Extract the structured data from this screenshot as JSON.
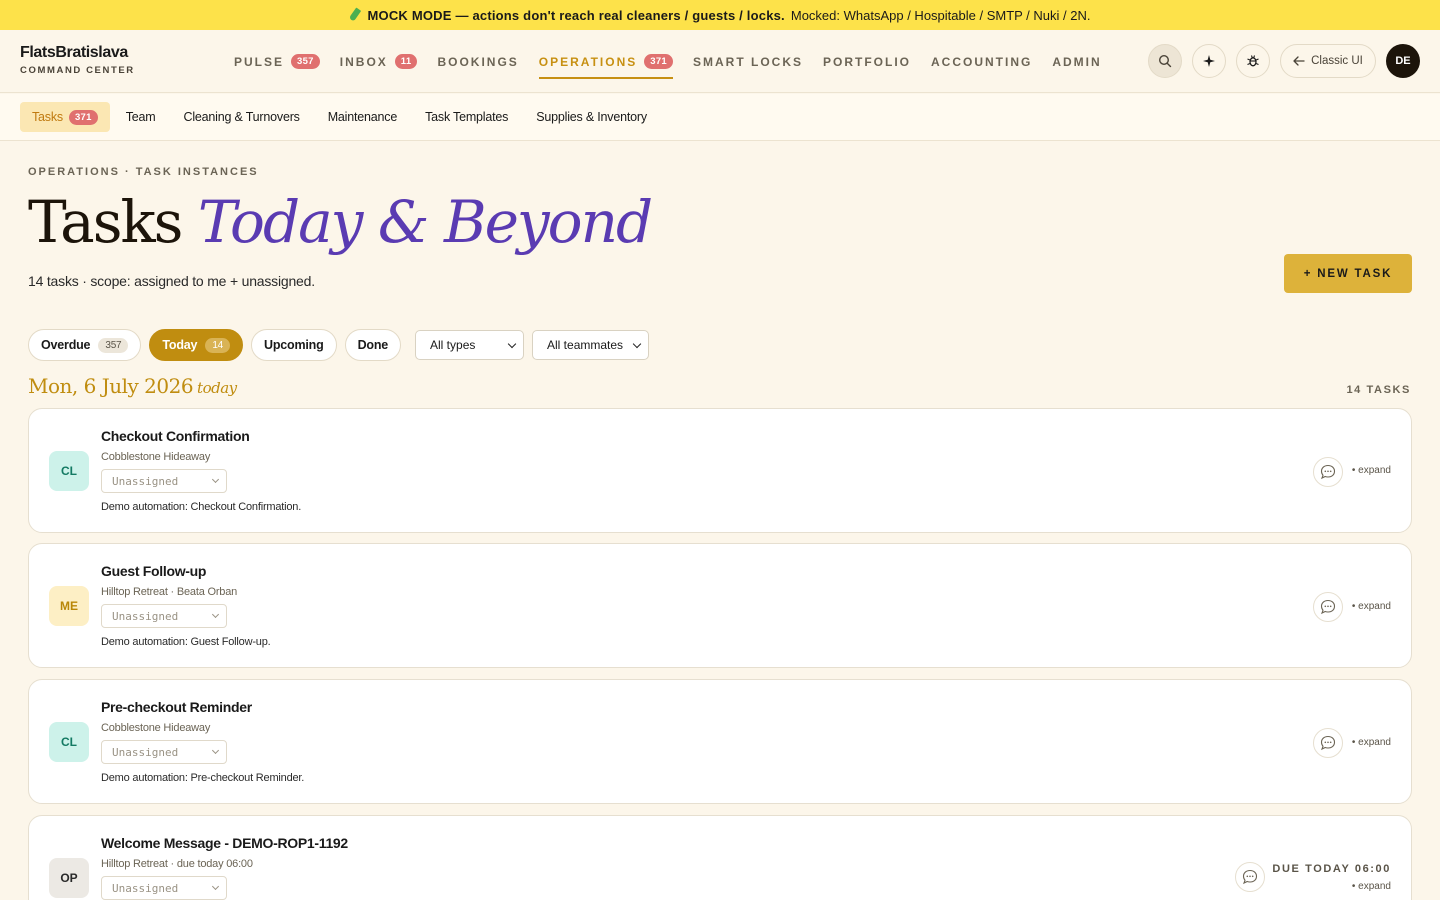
{
  "banner": {
    "icon": "flask-icon",
    "strong": "MOCK MODE — actions don't reach real cleaners / guests / locks.",
    "rest": "Mocked: WhatsApp / Hospitable / SMTP / Nuki / 2N."
  },
  "brand": {
    "name": "FlatsBratislava",
    "sub": "COMMAND CENTER"
  },
  "nav": [
    {
      "label": "PULSE",
      "badge": "357"
    },
    {
      "label": "INBOX",
      "badge": "11"
    },
    {
      "label": "BOOKINGS",
      "badge": ""
    },
    {
      "label": "OPERATIONS",
      "badge": "371",
      "active": true
    },
    {
      "label": "SMART LOCKS",
      "badge": ""
    },
    {
      "label": "PORTFOLIO",
      "badge": ""
    },
    {
      "label": "ACCOUNTING",
      "badge": ""
    },
    {
      "label": "ADMIN",
      "badge": ""
    }
  ],
  "actions": {
    "classic_label": "Classic UI",
    "avatar": "DE"
  },
  "subnav": [
    {
      "label": "Tasks",
      "badge": "371",
      "active": true
    },
    {
      "label": "Team"
    },
    {
      "label": "Cleaning & Turnovers"
    },
    {
      "label": "Maintenance"
    },
    {
      "label": "Task Templates"
    },
    {
      "label": "Supplies & Inventory"
    }
  ],
  "page": {
    "eyebrow": "OPERATIONS · TASK INSTANCES",
    "title_main": "Tasks ",
    "title_accent": "Today & Beyond",
    "scope": "14 tasks · scope: assigned to me + unassigned.",
    "new_task": "+ NEW TASK"
  },
  "filters": {
    "overdue": {
      "label": "Overdue",
      "count": "357"
    },
    "today": {
      "label": "Today",
      "count": "14"
    },
    "upcoming": "Upcoming",
    "done": "Done",
    "types": "All types",
    "teammates": "All teammates"
  },
  "day": {
    "date": "Mon, 6 July 2026",
    "today": "today",
    "count": "14 TASKS"
  },
  "tasks": [
    {
      "tag": "CL",
      "title": "Checkout Confirmation",
      "meta": "Cobblestone Hideaway",
      "assignee": "Unassigned",
      "desc": "Demo automation: Checkout Confirmation.",
      "expand": "• expand"
    },
    {
      "tag": "ME",
      "title": "Guest Follow-up",
      "meta": "Hilltop Retreat · Beata Orban",
      "assignee": "Unassigned",
      "desc": "Demo automation: Guest Follow-up.",
      "expand": "• expand"
    },
    {
      "tag": "CL",
      "title": "Pre-checkout Reminder",
      "meta": "Cobblestone Hideaway",
      "assignee": "Unassigned",
      "desc": "Demo automation: Pre-checkout Reminder.",
      "expand": "• expand"
    },
    {
      "tag": "OP",
      "title": "Welcome Message - DEMO-ROP1-1192",
      "meta": "Hilltop Retreat · due today 06:00",
      "assignee": "Unassigned",
      "due": "DUE TODAY 06:00",
      "expand": "• expand"
    }
  ]
}
